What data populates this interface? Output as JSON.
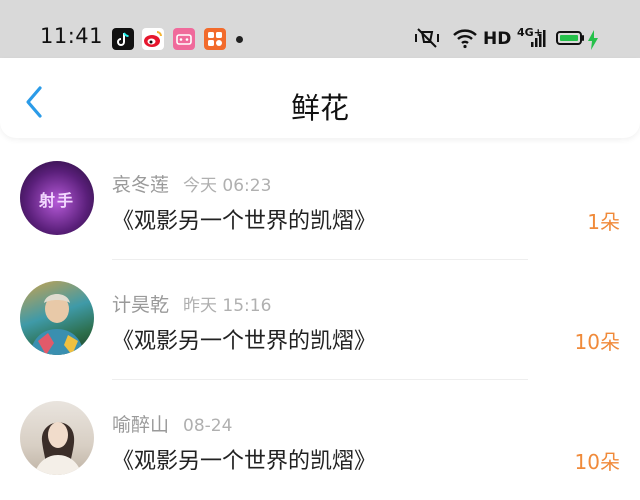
{
  "status_bar": {
    "time": "11:41",
    "apps": [
      {
        "name": "tiktok-app-icon",
        "color": "#111111"
      },
      {
        "name": "weibo-app-icon",
        "color": "#f4b32f"
      },
      {
        "name": "pink-app-icon",
        "color": "#f06a9b"
      },
      {
        "name": "orange-app-icon",
        "color": "#f26b2c"
      }
    ],
    "network_hd": "HD",
    "network_type": "4G+",
    "battery_color": "#25c04a"
  },
  "header": {
    "title": "鲜花",
    "back_icon": "chevron-left-icon",
    "accent_color": "#2b9be8"
  },
  "items": [
    {
      "name": "哀冬莲",
      "date": "今天 06:23",
      "title": "《观影另一个世界的凯熠》",
      "amount": "1朵",
      "avatar_text": "射手"
    },
    {
      "name": "计昊乾",
      "date": "昨天 15:16",
      "title": "《观影另一个世界的凯熠》",
      "amount": "10朵"
    },
    {
      "name": "喻醉山",
      "date": "08-24",
      "title": "《观影另一个世界的凯熠》",
      "amount": "10朵"
    }
  ],
  "colors": {
    "amount": "#f08a3a",
    "meta": "#9a9a9a"
  }
}
